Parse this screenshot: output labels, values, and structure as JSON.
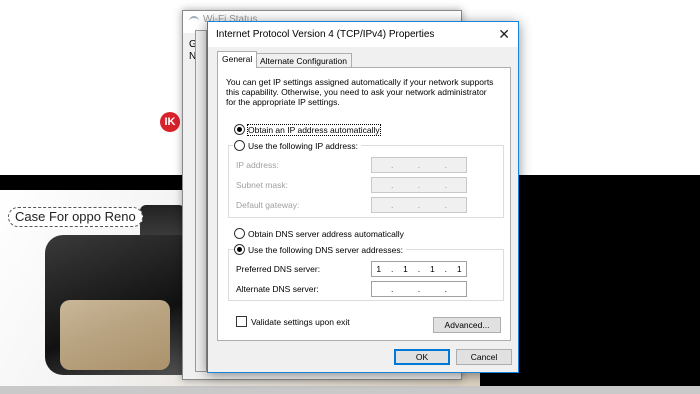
{
  "background": {
    "case_label": "Case For oppo Reno",
    "logo_text": "IK"
  },
  "back_window": {
    "title": "Wi-Fi Status",
    "letter_g": "G",
    "letter_n": "N"
  },
  "dialog": {
    "title": "Internet Protocol Version 4 (TCP/IPv4) Properties",
    "close_glyph": "✕",
    "tabs": [
      {
        "label": "General",
        "active": true
      },
      {
        "label": "Alternate Configuration",
        "active": false
      }
    ],
    "intro": "You can get IP settings assigned automatically if your network supports this capability. Otherwise, you need to ask your network administrator for the appropriate IP settings.",
    "ip_section": {
      "auto_label": "Obtain an IP address automatically",
      "auto_selected": true,
      "manual_label": "Use the following IP address:",
      "fields": [
        {
          "label": "IP address:",
          "octets": [
            "",
            "",
            "",
            ""
          ],
          "dots": [
            ".",
            ".",
            "."
          ]
        },
        {
          "label": "Subnet mask:",
          "octets": [
            "",
            "",
            "",
            ""
          ],
          "dots": [
            ".",
            ".",
            "."
          ]
        },
        {
          "label": "Default gateway:",
          "octets": [
            "",
            "",
            "",
            ""
          ],
          "dots": [
            ".",
            ".",
            "."
          ]
        }
      ]
    },
    "dns_section": {
      "auto_label": "Obtain DNS server address automatically",
      "manual_label": "Use the following DNS server addresses:",
      "manual_selected": true,
      "preferred_label": "Preferred DNS server:",
      "preferred_octets": [
        "1",
        "1",
        "1",
        "1"
      ],
      "alternate_label": "Alternate DNS server:",
      "alternate_octets": [
        "",
        "",
        "",
        ""
      ],
      "dot": "."
    },
    "validate_label": "Validate settings upon exit",
    "validate_checked": false,
    "advanced_button": "Advanced...",
    "ok_button": "OK",
    "cancel_button": "Cancel"
  },
  "colors": {
    "accent": "#0078d7",
    "disabled_text": "#a0a0a0",
    "logo_red": "#d8222b"
  }
}
